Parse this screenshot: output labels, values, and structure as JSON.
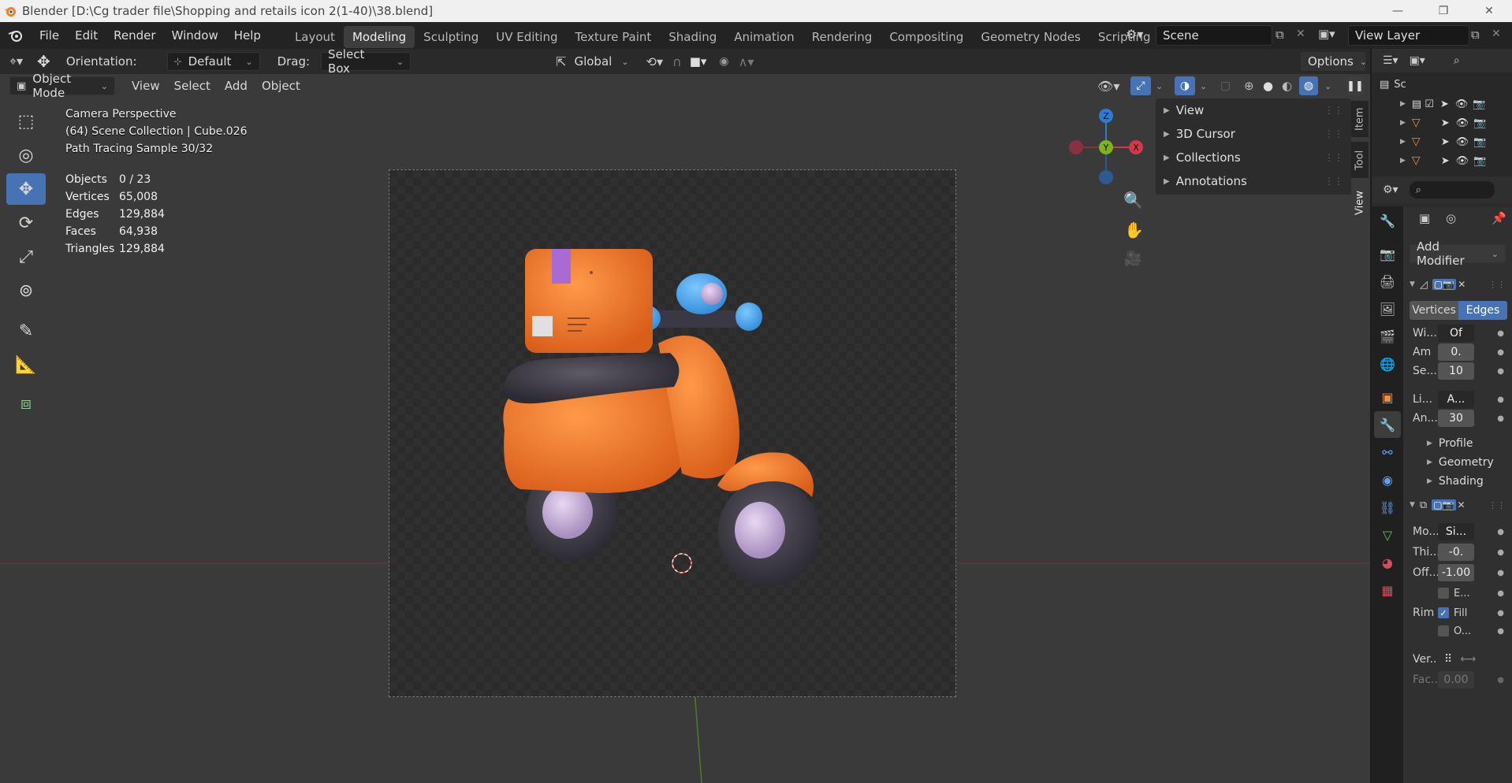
{
  "window": {
    "title": "Blender [D:\\Cg trader file\\Shopping and retails icon 2(1-40)\\38.blend]",
    "minimize": "—",
    "maximize": "❐",
    "close": "✕"
  },
  "menus": [
    "File",
    "Edit",
    "Render",
    "Window",
    "Help"
  ],
  "workspaces": [
    "Layout",
    "Modeling",
    "Sculpting",
    "UV Editing",
    "Texture Paint",
    "Shading",
    "Animation",
    "Rendering",
    "Compositing",
    "Geometry Nodes",
    "Scripting",
    "+"
  ],
  "active_workspace": "Modeling",
  "scene": {
    "name": "Scene",
    "view_layer": "View Layer"
  },
  "tool_header": {
    "orientation_label": "Orientation:",
    "orientation_value": "Default",
    "drag_label": "Drag:",
    "drag_value": "Select Box",
    "transform_space": "Global",
    "options": "Options"
  },
  "viewport_header": {
    "mode": "Object Mode",
    "menus": [
      "View",
      "Select",
      "Add",
      "Object"
    ]
  },
  "overlay": {
    "line1": "Camera Perspective",
    "line2": "(64) Scene Collection | Cube.026",
    "line3": "Path Tracing Sample 30/32",
    "stats": [
      {
        "k": "Objects",
        "v": "0 / 23"
      },
      {
        "k": "Vertices",
        "v": "65,008"
      },
      {
        "k": "Edges",
        "v": "129,884"
      },
      {
        "k": "Faces",
        "v": "64,938"
      },
      {
        "k": "Triangles",
        "v": "129,884"
      }
    ]
  },
  "gizmo": {
    "z": "Z",
    "y": "Y",
    "x": "X"
  },
  "npanel": {
    "items": [
      "View",
      "3D Cursor",
      "Collections",
      "Annotations"
    ],
    "tabs": [
      "Item",
      "Tool",
      "View"
    ]
  },
  "outliner": {
    "root": "Sc"
  },
  "properties": {
    "add_modifier": "Add Modifier",
    "bevel": {
      "vertices": "Vertices",
      "edges": "Edges",
      "rows": [
        {
          "label": "Wi...",
          "value": "Of"
        },
        {
          "label": "Am",
          "value": "0."
        },
        {
          "label": "Se...",
          "value": "10"
        },
        {
          "label": "Li...",
          "value": "A..."
        },
        {
          "label": "An...",
          "value": "30"
        }
      ],
      "subpanels": [
        "Profile",
        "Geometry",
        "Shading"
      ]
    },
    "solidify": {
      "rows": [
        {
          "label": "Mo...",
          "value": "Si..."
        },
        {
          "label": "Thi...",
          "value": "-0."
        },
        {
          "label": "Off...",
          "value": "-1.00"
        }
      ],
      "even": "E...",
      "rim_label": "Rim",
      "fill": "Fill",
      "only": "O...",
      "vert_label": "Ver...",
      "fac_label": "Fac...",
      "fac_value": "0.00"
    }
  },
  "colors": {
    "accent": "#4772b3",
    "orange": "#f07a2e",
    "x_axis": "#d03a4a",
    "y_axis": "#7cb420",
    "z_axis": "#2f7bd0"
  }
}
